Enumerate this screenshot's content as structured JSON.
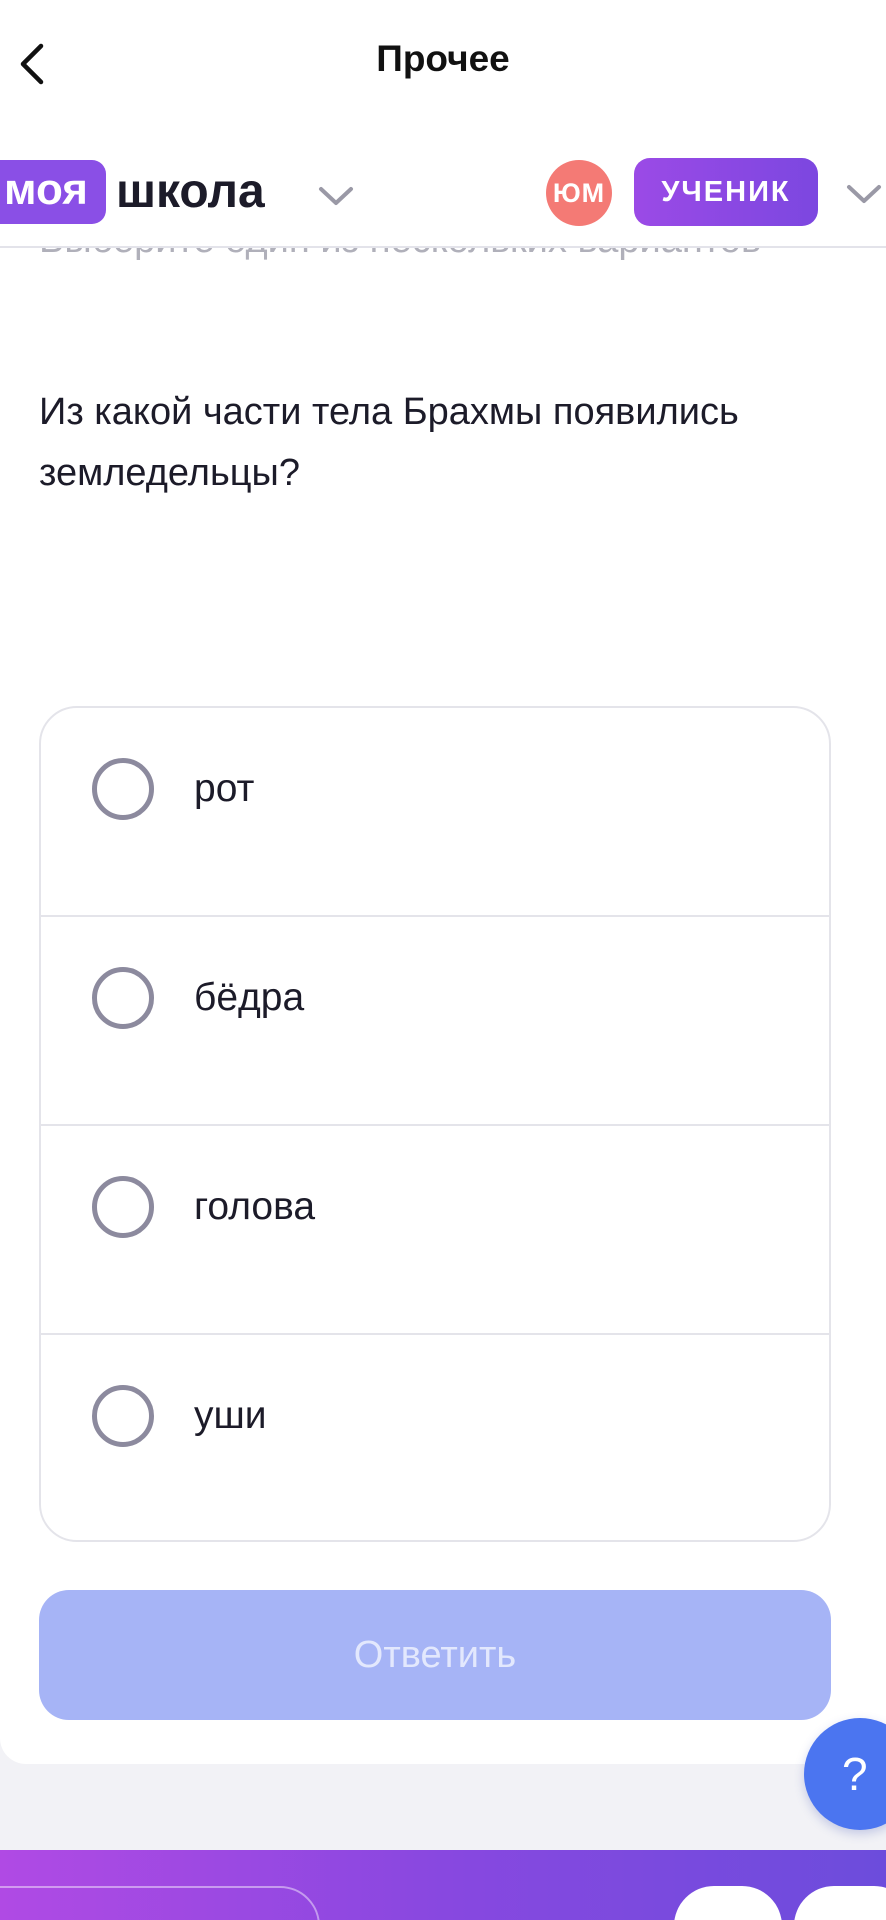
{
  "nav": {
    "title": "Прочее",
    "back_icon": "chevron-left-icon"
  },
  "header": {
    "logo_highlight": "моя",
    "logo_text": "школа",
    "avatar_initials": "ЮМ",
    "role_label": "УЧЕНИК",
    "colors": {
      "logo_pill": "#8a4fe6",
      "avatar": "#f47a75",
      "role_badge": "#8a48e3"
    }
  },
  "task": {
    "instruction": "Выберите один из нескольких вариантов",
    "question": "Из какой части тела Брахмы появились земледельцы?",
    "options": [
      {
        "label": "рот",
        "selected": false
      },
      {
        "label": "бёдра",
        "selected": false
      },
      {
        "label": "голова",
        "selected": false
      },
      {
        "label": "уши",
        "selected": false
      }
    ],
    "submit_label": "Ответить",
    "submit_enabled": false
  },
  "help": {
    "label": "?"
  }
}
